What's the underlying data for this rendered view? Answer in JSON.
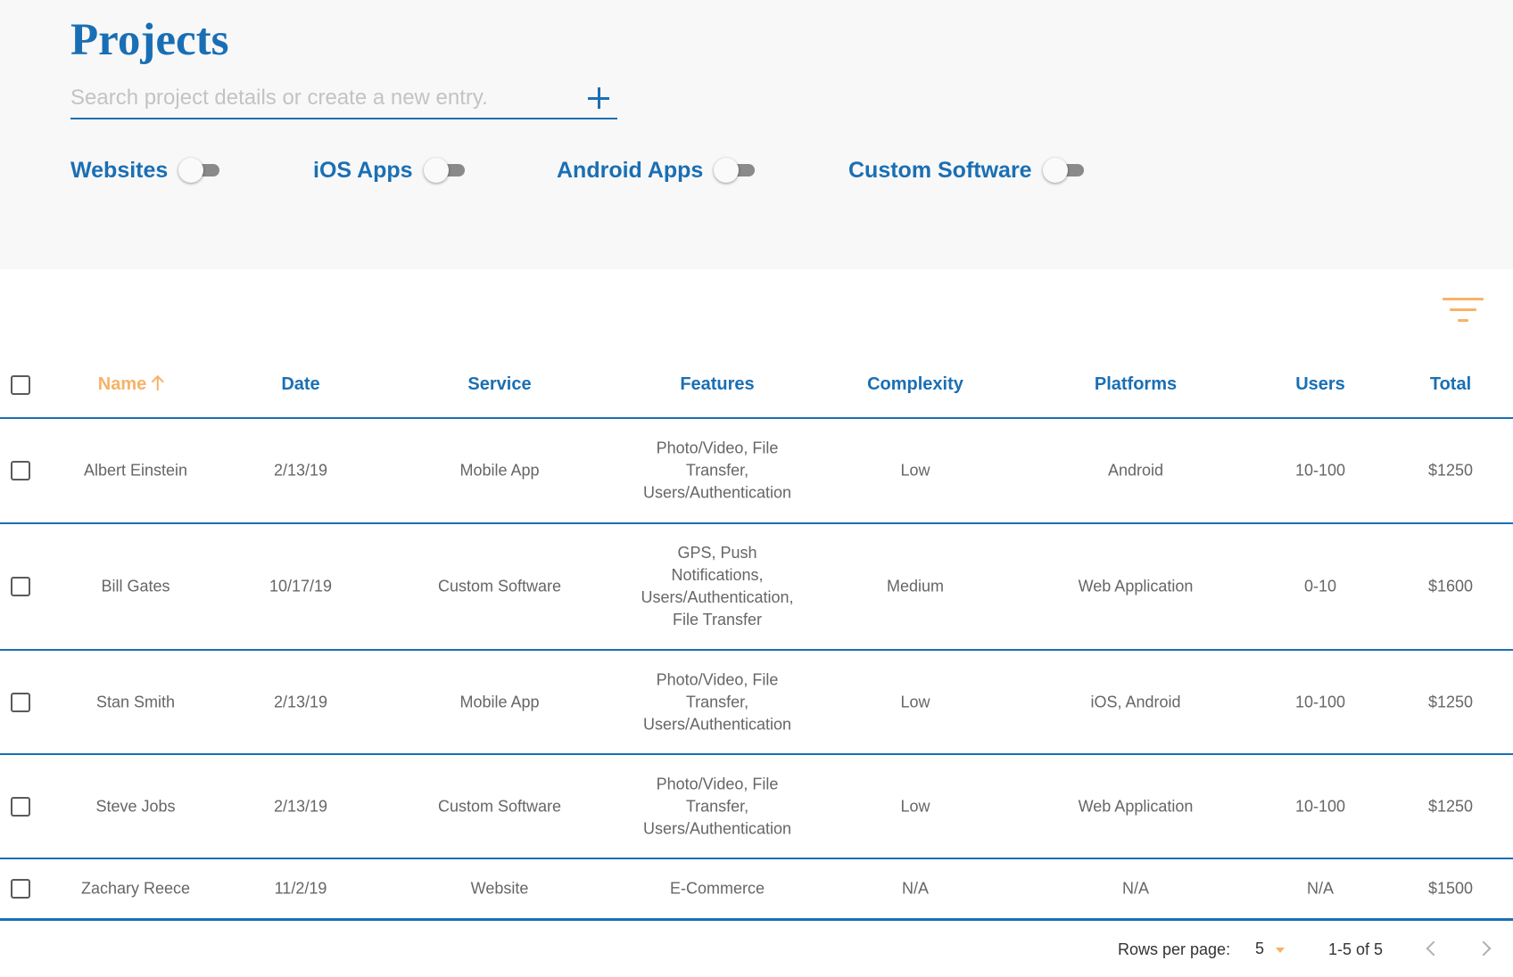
{
  "header": {
    "title": "Projects",
    "search_placeholder": "Search project details or create a new entry.",
    "search_value": "",
    "add_icon": "plus-icon"
  },
  "filters": [
    {
      "label": "Websites",
      "on": false
    },
    {
      "label": "iOS Apps",
      "on": false
    },
    {
      "label": "Android Apps",
      "on": false
    },
    {
      "label": "Custom Software",
      "on": false
    }
  ],
  "filter_icon": "filter-list-icon",
  "colors": {
    "primary": "#1a6fb4",
    "accent": "#f7b267"
  },
  "table": {
    "sort_column": "Name",
    "sort_direction": "ascending",
    "columns": [
      "Name",
      "Date",
      "Service",
      "Features",
      "Complexity",
      "Platforms",
      "Users",
      "Total"
    ],
    "rows": [
      {
        "name": "Albert Einstein",
        "date": "2/13/19",
        "service": "Mobile App",
        "features": [
          "Photo/Video, File",
          "Transfer,",
          "Users/Authentication"
        ],
        "complexity": "Low",
        "platforms": "Android",
        "users": "10-100",
        "total": "$1250"
      },
      {
        "name": "Bill Gates",
        "date": "10/17/19",
        "service": "Custom Software",
        "features": [
          "GPS, Push",
          "Notifications,",
          "Users/Authentication,",
          "File Transfer"
        ],
        "complexity": "Medium",
        "platforms": "Web Application",
        "users": "0-10",
        "total": "$1600"
      },
      {
        "name": "Stan Smith",
        "date": "2/13/19",
        "service": "Mobile App",
        "features": [
          "Photo/Video, File",
          "Transfer,",
          "Users/Authentication"
        ],
        "complexity": "Low",
        "platforms": "iOS, Android",
        "users": "10-100",
        "total": "$1250"
      },
      {
        "name": "Steve Jobs",
        "date": "2/13/19",
        "service": "Custom Software",
        "features": [
          "Photo/Video, File",
          "Transfer,",
          "Users/Authentication"
        ],
        "complexity": "Low",
        "platforms": "Web Application",
        "users": "10-100",
        "total": "$1250"
      },
      {
        "name": "Zachary Reece",
        "date": "11/2/19",
        "service": "Website",
        "features": [
          "E-Commerce"
        ],
        "complexity": "N/A",
        "platforms": "N/A",
        "users": "N/A",
        "total": "$1500"
      }
    ]
  },
  "pagination": {
    "rows_per_page_label": "Rows per page:",
    "rows_per_page": "5",
    "range": "1-5 of 5"
  }
}
